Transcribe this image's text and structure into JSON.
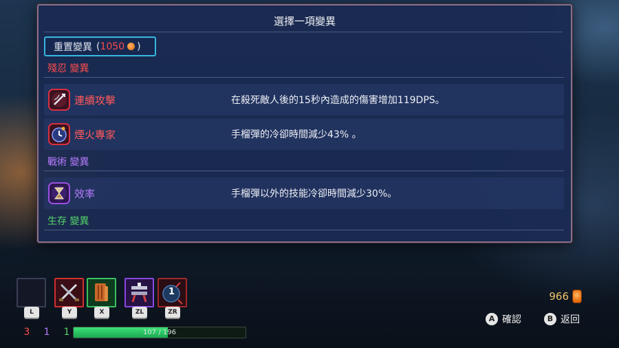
{
  "modal": {
    "title": "選擇一項變異",
    "reset": {
      "label": "重置變異",
      "open": "(",
      "cost": "1050",
      "close": ")"
    },
    "categories": [
      {
        "label": "殘忍 變異",
        "color": "#ff4d4d"
      },
      {
        "label": "戰術 變異",
        "color": "#b77cff"
      },
      {
        "label": "生存 變異",
        "color": "#55d46a"
      }
    ],
    "mutations": [
      {
        "name": "連續攻擊",
        "desc": "在殺死敵人後的15秒內造成的傷害增加119DPS。",
        "color": "#ff5a5a",
        "icon": "crossbow-icon"
      },
      {
        "name": "煙火專家",
        "desc": "手榴彈的冷卻時間減少43%  。",
        "color": "#ff5a5a",
        "icon": "clock-grenade-icon"
      },
      {
        "name": "效率",
        "desc": "手榴彈以外的技能冷卻時間減少30%。",
        "color": "#b77cff",
        "icon": "hourglass-icon"
      }
    ]
  },
  "hud": {
    "slots": [
      {
        "key": "L",
        "icon": "empty-slot"
      },
      {
        "key": "Y",
        "icon": "crossed-swords-icon"
      },
      {
        "key": "X",
        "icon": "scroll-icon"
      },
      {
        "key": "ZL",
        "icon": "turret-icon"
      },
      {
        "key": "ZR",
        "icon": "grenade-icon",
        "count": "1"
      }
    ],
    "stats": [
      {
        "value": "3",
        "color": "#ff4d4d"
      },
      {
        "value": "1",
        "color": "#b77cff"
      },
      {
        "value": "1",
        "color": "#55d46a"
      }
    ],
    "hp": {
      "current": "107",
      "sep": "/",
      "max": "196",
      "fraction": 0.546
    },
    "gold": "966",
    "hints": [
      {
        "key": "A",
        "label": "確認"
      },
      {
        "key": "B",
        "label": "返回"
      }
    ]
  }
}
